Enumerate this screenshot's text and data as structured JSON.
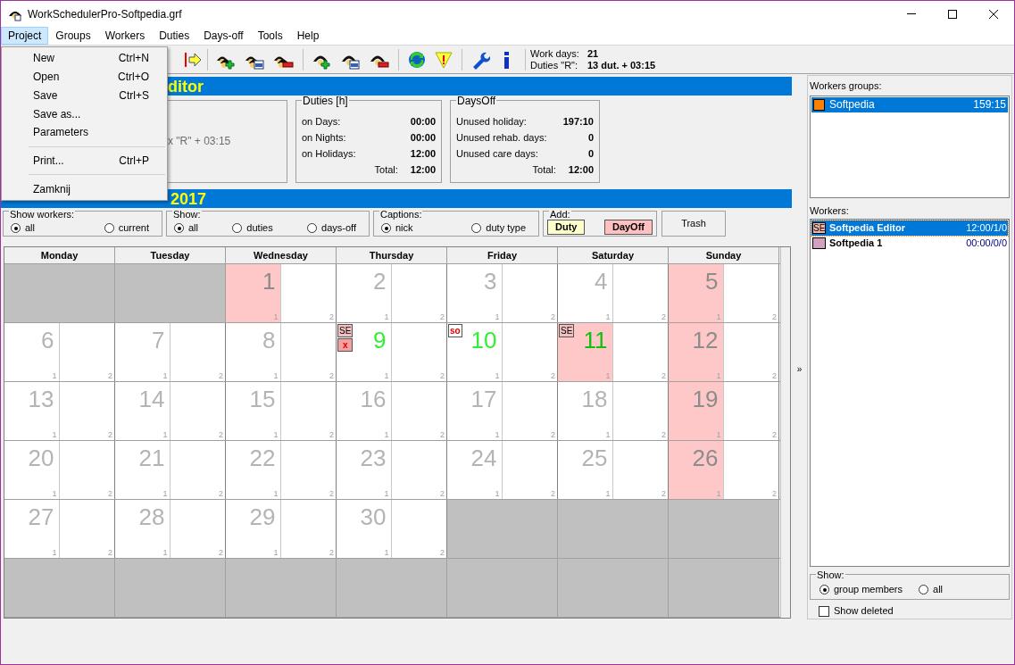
{
  "window": {
    "title": "WorkSchedulerPro-Softpedia.grf"
  },
  "menu_bar": [
    {
      "label": "Project",
      "selected": true
    },
    {
      "label": "Groups",
      "selected": false
    },
    {
      "label": "Workers",
      "selected": false
    },
    {
      "label": "Duties",
      "selected": false
    },
    {
      "label": "Days-off",
      "selected": false
    },
    {
      "label": "Tools",
      "selected": false
    },
    {
      "label": "Help",
      "selected": false
    }
  ],
  "open_menu": [
    {
      "kind": "item",
      "label": "New",
      "shortcut": "Ctrl+N"
    },
    {
      "kind": "item",
      "label": "Open",
      "shortcut": "Ctrl+O"
    },
    {
      "kind": "item",
      "label": "Save",
      "shortcut": "Ctrl+S"
    },
    {
      "kind": "item",
      "label": "Save as..."
    },
    {
      "kind": "item",
      "label": "Parameters"
    },
    {
      "kind": "separator"
    },
    {
      "kind": "item",
      "label": "Print...",
      "shortcut": "Ctrl+P"
    },
    {
      "kind": "separator"
    },
    {
      "kind": "item",
      "label": "Zamknij"
    }
  ],
  "toolbar_summary": [
    {
      "label": "Work days:",
      "value": "21"
    },
    {
      "label": "Duties \"R\":",
      "value": "13 dut. + 03:15"
    }
  ],
  "editor_header": {
    "title": "ditor"
  },
  "worker_box": {
    "text": "x \"R\" + 03:15"
  },
  "duties_box": {
    "title": "Duties [h]",
    "rows": [
      {
        "kind": "row",
        "label": "on Days:",
        "value": "00:00"
      },
      {
        "kind": "row",
        "label": "on Nights:",
        "value": "00:00"
      },
      {
        "kind": "row",
        "label": "on Holidays:",
        "value": "12:00"
      },
      {
        "kind": "total",
        "label": "Total:",
        "value": "12:00"
      }
    ]
  },
  "days_off_box": {
    "title": "DaysOff",
    "rows": [
      {
        "kind": "row",
        "label": "Unused holiday:",
        "value": "197:10"
      },
      {
        "kind": "row",
        "label": "Unused rehab. days:",
        "value": "0"
      },
      {
        "kind": "row",
        "label": "Unused care days:",
        "value": "0"
      },
      {
        "kind": "total",
        "label": "Total:",
        "value": "12:00"
      }
    ]
  },
  "calendar_header": {
    "title": "2017"
  },
  "filters": [
    {
      "title": "Show workers:",
      "options": [
        {
          "label": "all",
          "selected": true
        },
        {
          "label": "current",
          "selected": false
        }
      ]
    },
    {
      "title": "Show:",
      "options": [
        {
          "label": "all",
          "selected": true
        },
        {
          "label": "duties",
          "selected": false
        },
        {
          "label": "days-off",
          "selected": false
        }
      ]
    },
    {
      "title": "Captions:",
      "options": [
        {
          "label": "nick",
          "selected": true
        },
        {
          "label": "duty type",
          "selected": false
        }
      ]
    }
  ],
  "add": {
    "title": "Add:",
    "buttons": [
      {
        "label": "Duty",
        "color": "#ffffcc"
      },
      {
        "label": "DayOff",
        "color": "#ffc0c0"
      }
    ]
  },
  "trash_button": {
    "label": "Trash"
  },
  "calendar": {
    "weekdays": [
      "Monday",
      "Tuesday",
      "Wednesday",
      "Thursday",
      "Friday",
      "Saturday",
      "Sunday"
    ],
    "weeks": [
      [
        {
          "kind": "blank"
        },
        {
          "kind": "blank"
        },
        {
          "day": "1",
          "holiday": true,
          "has_duty": false,
          "shifts": [
            "1",
            "2"
          ]
        },
        {
          "day": "2",
          "holiday": false,
          "has_duty": false,
          "shifts": [
            "1",
            "2"
          ]
        },
        {
          "day": "3",
          "holiday": false,
          "has_duty": false,
          "shifts": [
            "1",
            "2"
          ]
        },
        {
          "day": "4",
          "holiday": false,
          "has_duty": false,
          "shifts": [
            "1",
            "2"
          ]
        },
        {
          "day": "5",
          "holiday": true,
          "has_duty": false,
          "shifts": [
            "1",
            "2"
          ]
        }
      ],
      [
        {
          "day": "6",
          "holiday": false,
          "has_duty": false,
          "shifts": [
            "1",
            "2"
          ]
        },
        {
          "day": "7",
          "holiday": false,
          "has_duty": false,
          "shifts": [
            "1",
            "2"
          ]
        },
        {
          "day": "8",
          "holiday": false,
          "has_duty": false,
          "shifts": [
            "1",
            "2"
          ]
        },
        {
          "day": "9",
          "holiday": false,
          "has_duty": true,
          "shifts": [
            "1",
            "2"
          ],
          "tags": [
            {
              "kind": "nick",
              "label": "SE"
            },
            {
              "kind": "cancel",
              "label": "x"
            }
          ]
        },
        {
          "day": "10",
          "holiday": false,
          "has_duty": true,
          "shifts": [
            "1",
            "2"
          ],
          "tags": [
            {
              "kind": "dayoff",
              "label": "so"
            }
          ]
        },
        {
          "day": "11",
          "holiday": true,
          "has_duty": true,
          "shifts": [
            "1",
            "2"
          ],
          "tags": [
            {
              "kind": "nick",
              "label": "SE"
            }
          ]
        },
        {
          "day": "12",
          "holiday": true,
          "has_duty": false,
          "shifts": [
            "1",
            "2"
          ]
        }
      ],
      [
        {
          "day": "13",
          "holiday": false,
          "has_duty": false,
          "shifts": [
            "1",
            "2"
          ]
        },
        {
          "day": "14",
          "holiday": false,
          "has_duty": false,
          "shifts": [
            "1",
            "2"
          ]
        },
        {
          "day": "15",
          "holiday": false,
          "has_duty": false,
          "shifts": [
            "1",
            "2"
          ]
        },
        {
          "day": "16",
          "holiday": false,
          "has_duty": false,
          "shifts": [
            "1",
            "2"
          ]
        },
        {
          "day": "17",
          "holiday": false,
          "has_duty": false,
          "shifts": [
            "1",
            "2"
          ]
        },
        {
          "day": "18",
          "holiday": false,
          "has_duty": false,
          "shifts": [
            "1",
            "2"
          ]
        },
        {
          "day": "19",
          "holiday": true,
          "has_duty": false,
          "shifts": [
            "1",
            "2"
          ]
        }
      ],
      [
        {
          "day": "20",
          "holiday": false,
          "has_duty": false,
          "shifts": [
            "1",
            "2"
          ]
        },
        {
          "day": "21",
          "holiday": false,
          "has_duty": false,
          "shifts": [
            "1",
            "2"
          ]
        },
        {
          "day": "22",
          "holiday": false,
          "has_duty": false,
          "shifts": [
            "1",
            "2"
          ]
        },
        {
          "day": "23",
          "holiday": false,
          "has_duty": false,
          "shifts": [
            "1",
            "2"
          ]
        },
        {
          "day": "24",
          "holiday": false,
          "has_duty": false,
          "shifts": [
            "1",
            "2"
          ]
        },
        {
          "day": "25",
          "holiday": false,
          "has_duty": false,
          "shifts": [
            "1",
            "2"
          ]
        },
        {
          "day": "26",
          "holiday": true,
          "has_duty": false,
          "shifts": [
            "1",
            "2"
          ]
        }
      ],
      [
        {
          "day": "27",
          "holiday": false,
          "has_duty": false,
          "shifts": [
            "1",
            "2"
          ]
        },
        {
          "day": "28",
          "holiday": false,
          "has_duty": false,
          "shifts": [
            "1",
            "2"
          ]
        },
        {
          "day": "29",
          "holiday": false,
          "has_duty": false,
          "shifts": [
            "1",
            "2"
          ]
        },
        {
          "day": "30",
          "holiday": false,
          "has_duty": false,
          "shifts": [
            "1",
            "2"
          ]
        },
        {
          "kind": "blank"
        },
        {
          "kind": "blank"
        },
        {
          "kind": "blank"
        }
      ],
      [
        {
          "kind": "blank"
        },
        {
          "kind": "blank"
        },
        {
          "kind": "blank"
        },
        {
          "kind": "blank"
        },
        {
          "kind": "blank"
        },
        {
          "kind": "blank"
        },
        {
          "kind": "blank"
        }
      ]
    ]
  },
  "collapse_glyph": "»",
  "sidebar": {
    "groups_label": "Workers groups:",
    "groups": [
      {
        "name": "Softpedia",
        "hours": "159:15",
        "color": "#ff8000",
        "selected": true
      }
    ],
    "workers_label": "Workers:",
    "workers": [
      {
        "nick": "SE",
        "name": "Softpedia Editor",
        "stats": "12:00/1/0",
        "color": "#f0b4a8",
        "selected": true
      },
      {
        "name": "Softpedia 1",
        "stats": "00:00/0/0",
        "color": "#d4a0c0",
        "selected": false
      }
    ],
    "show": {
      "title": "Show:",
      "options": [
        {
          "label": "group members",
          "selected": true
        },
        {
          "label": "all",
          "selected": false
        }
      ]
    },
    "show_deleted": {
      "label": "Show deleted",
      "checked": false
    }
  }
}
